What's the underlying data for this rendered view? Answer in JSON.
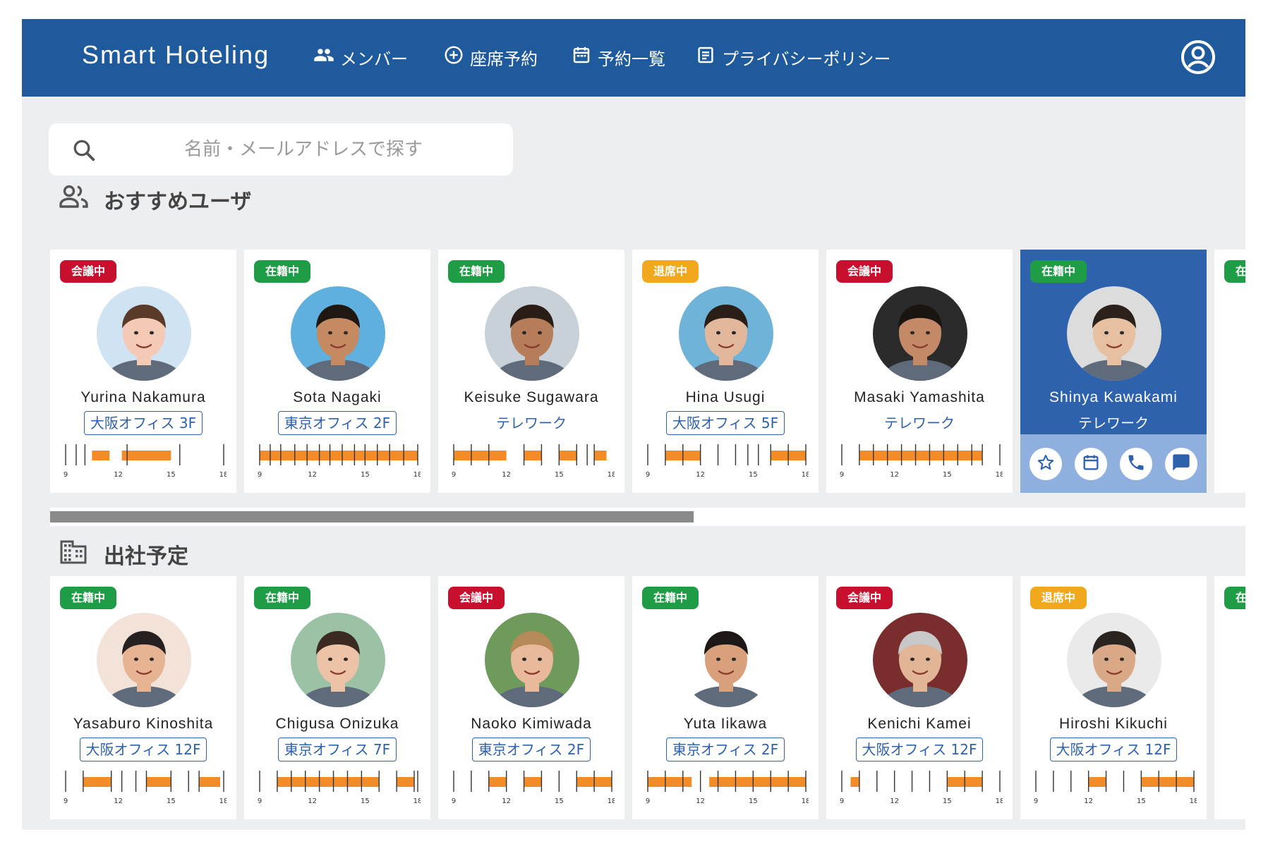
{
  "header": {
    "brand": "Smart Hoteling",
    "nav": [
      {
        "label": "メンバー",
        "icon": "people-icon"
      },
      {
        "label": "座席予約",
        "icon": "add-circle-icon"
      },
      {
        "label": "予約一覧",
        "icon": "calendar-icon"
      },
      {
        "label": "プライバシーポリシー",
        "icon": "document-icon"
      }
    ],
    "account_icon": "account-circle-icon"
  },
  "search": {
    "placeholder": "名前・メールアドレスで探す",
    "value": ""
  },
  "sections": {
    "recommended": {
      "title": "おすすめユーザ",
      "icon": "people-icon"
    },
    "schedule": {
      "title": "出社予定",
      "icon": "building-icon"
    }
  },
  "timeline": {
    "ticks": [
      "9",
      "12",
      "15",
      "18"
    ]
  },
  "status_colors": {
    "会議中": "#c8102e",
    "在籍中": "#1f9d46",
    "退席中": "#f2a81d"
  },
  "recommended_users": [
    {
      "status": "会議中",
      "name": "Yurina Nakamura",
      "location": "大阪オフィス 3F",
      "boxed": true,
      "bars": [
        [
          10.5,
          11.5
        ],
        [
          12.2,
          15.0
        ]
      ],
      "lines": [
        9.0,
        9.6,
        10.1,
        12.5,
        15.5,
        18.0
      ]
    },
    {
      "status": "在籍中",
      "name": "Sota Nagaki",
      "location": "東京オフィス 2F",
      "boxed": true,
      "bars": [
        [
          9.0,
          18.0
        ]
      ],
      "lines": [
        9.0,
        9.6,
        10.2,
        11.0,
        11.7,
        12.4,
        13.0,
        13.7,
        14.4,
        15.0,
        15.7,
        16.4,
        17.2,
        18.0
      ]
    },
    {
      "status": "在籍中",
      "name": "Keisuke Sugawara",
      "location": "テレワーク",
      "boxed": false,
      "bars": [
        [
          9.0,
          12.0
        ],
        [
          13.0,
          14.0
        ],
        [
          15.0,
          16.0
        ],
        [
          17.0,
          17.7
        ]
      ],
      "lines": [
        9.0,
        10.0,
        11.0,
        13.0,
        14.0,
        15.0,
        16.0,
        16.6,
        17.0
      ]
    },
    {
      "status": "退席中",
      "name": "Hina Usugi",
      "location": "大阪オフィス 5F",
      "boxed": true,
      "bars": [
        [
          10.0,
          12.0
        ],
        [
          16.0,
          18.0
        ]
      ],
      "lines": [
        9.0,
        10.0,
        11.0,
        12.0,
        13.0,
        14.0,
        14.7,
        15.3,
        16.0,
        17.0,
        18.0
      ]
    },
    {
      "status": "会議中",
      "name": "Masaki Yamashita",
      "location": "テレワーク",
      "boxed": false,
      "bars": [
        [
          10.0,
          17.0
        ]
      ],
      "lines": [
        9.0,
        10.0,
        10.8,
        11.6,
        12.4,
        13.2,
        14.0,
        14.8,
        15.6,
        16.4,
        17.0,
        18.0
      ]
    },
    {
      "status": "在籍中",
      "name": "Shinya Kawakami",
      "location": "テレワーク",
      "boxed": false,
      "selected": true,
      "actions": [
        {
          "icon": "star-icon"
        },
        {
          "icon": "calendar-icon"
        },
        {
          "icon": "phone-icon"
        },
        {
          "icon": "chat-icon"
        }
      ]
    },
    {
      "status": "在籍中",
      "partial": true
    }
  ],
  "schedule_users": [
    {
      "status": "在籍中",
      "name": "Yasaburo Kinoshita",
      "location": "大阪オフィス 12F",
      "boxed": true,
      "bars": [
        [
          10.0,
          11.6
        ],
        [
          13.6,
          15.0
        ],
        [
          16.6,
          17.8
        ]
      ],
      "lines": [
        9.0,
        10.0,
        11.6,
        12.2,
        13.0,
        13.6,
        15.0,
        16.0,
        16.6,
        18.0
      ]
    },
    {
      "status": "在籍中",
      "name": "Chigusa Onizuka",
      "location": "東京オフィス 7F",
      "boxed": true,
      "bars": [
        [
          10.0,
          15.8
        ],
        [
          16.8,
          17.8
        ]
      ],
      "lines": [
        9.0,
        10.0,
        10.8,
        11.6,
        12.4,
        13.2,
        14.0,
        14.8,
        15.8,
        16.8,
        17.8,
        18.0
      ]
    },
    {
      "status": "会議中",
      "name": "Naoko Kimiwada",
      "location": "東京オフィス 2F",
      "boxed": true,
      "bars": [
        [
          11.0,
          12.0
        ],
        [
          13.0,
          14.0
        ],
        [
          16.0,
          18.0
        ]
      ],
      "lines": [
        9.0,
        10.0,
        11.0,
        12.0,
        13.0,
        14.0,
        15.0,
        16.0,
        17.0,
        18.0
      ]
    },
    {
      "status": "在籍中",
      "name": "Yuta Iikawa",
      "location": "東京オフィス 2F",
      "boxed": true,
      "bars": [
        [
          9.0,
          11.5
        ],
        [
          12.5,
          18.0
        ]
      ],
      "lines": [
        9.0,
        10.0,
        11.0,
        12.0,
        13.0,
        14.0,
        15.0,
        16.0,
        17.0,
        18.0
      ]
    },
    {
      "status": "会議中",
      "name": "Kenichi Kamei",
      "location": "大阪オフィス 12F",
      "boxed": true,
      "bars": [
        [
          9.5,
          10.0
        ],
        [
          15.0,
          17.0
        ]
      ],
      "lines": [
        9.0,
        10.0,
        11.0,
        12.0,
        13.0,
        14.0,
        15.0,
        16.0,
        17.0,
        18.0
      ]
    },
    {
      "status": "退席中",
      "name": "Hiroshi Kikuchi",
      "location": "大阪オフィス 12F",
      "boxed": true,
      "bars": [
        [
          12.0,
          13.0
        ],
        [
          15.0,
          18.0
        ]
      ],
      "lines": [
        9.0,
        10.0,
        11.0,
        12.0,
        13.0,
        14.0,
        15.0,
        16.0,
        17.0,
        18.0
      ]
    },
    {
      "status": "在籍中",
      "partial": true
    }
  ]
}
